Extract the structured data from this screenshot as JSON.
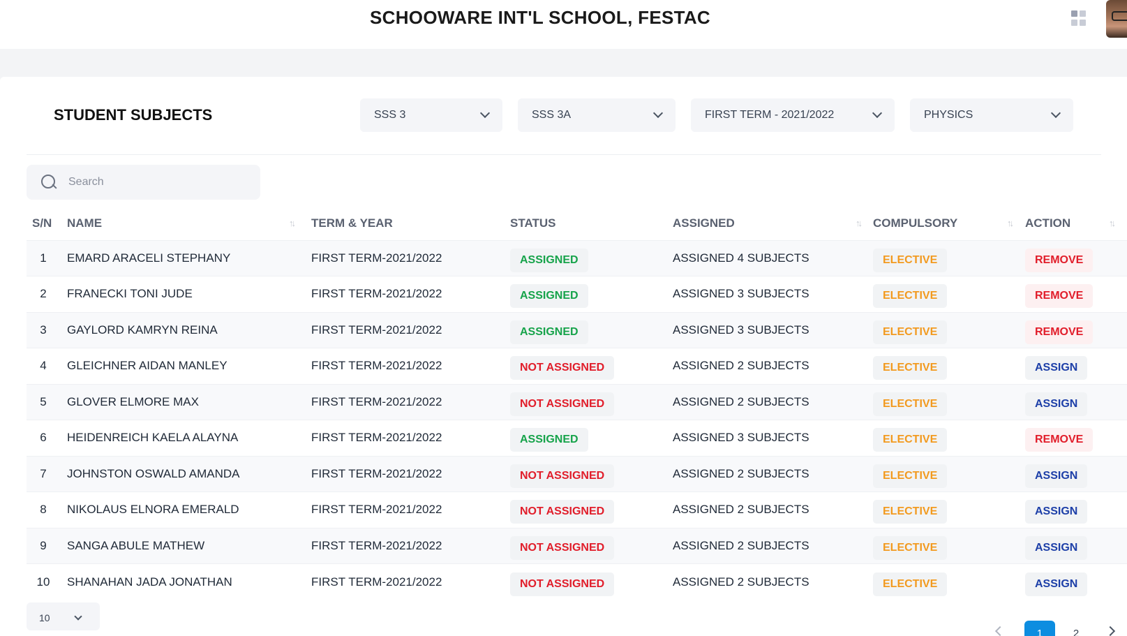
{
  "header": {
    "school_name": "SCHOOWARE INT'L SCHOOL, FESTAC",
    "apps_icon": "grid-apps-icon",
    "avatar_icon": "user-avatar"
  },
  "page": {
    "title": "STUDENT SUBJECTS",
    "filters": {
      "class": "SSS 3",
      "arm": "SSS 3A",
      "term": "FIRST TERM - 2021/2022",
      "subject": "PHYSICS"
    },
    "search": {
      "placeholder": "Search",
      "value": ""
    }
  },
  "table": {
    "columns": {
      "sn": "S/N",
      "name": "NAME",
      "term_year": "TERM & YEAR",
      "status": "STATUS",
      "assigned": "ASSIGNED",
      "compulsory": "COMPULSORY",
      "action": "ACTION"
    },
    "sort_glyph": "↑↓",
    "rows": [
      {
        "sn": "1",
        "name": "EMARD ARACELI STEPHANY",
        "term_year": "FIRST TERM-2021/2022",
        "status": "ASSIGNED",
        "assigned": "ASSIGNED 4 SUBJECTS",
        "compulsory": "ELECTIVE",
        "action": "REMOVE"
      },
      {
        "sn": "2",
        "name": "FRANECKI TONI JUDE",
        "term_year": "FIRST TERM-2021/2022",
        "status": "ASSIGNED",
        "assigned": "ASSIGNED 3 SUBJECTS",
        "compulsory": "ELECTIVE",
        "action": "REMOVE"
      },
      {
        "sn": "3",
        "name": "GAYLORD KAMRYN REINA",
        "term_year": "FIRST TERM-2021/2022",
        "status": "ASSIGNED",
        "assigned": "ASSIGNED 3 SUBJECTS",
        "compulsory": "ELECTIVE",
        "action": "REMOVE"
      },
      {
        "sn": "4",
        "name": "GLEICHNER AIDAN MANLEY",
        "term_year": "FIRST TERM-2021/2022",
        "status": "NOT ASSIGNED",
        "assigned": "ASSIGNED 2 SUBJECTS",
        "compulsory": "ELECTIVE",
        "action": "ASSIGN"
      },
      {
        "sn": "5",
        "name": "GLOVER ELMORE MAX",
        "term_year": "FIRST TERM-2021/2022",
        "status": "NOT ASSIGNED",
        "assigned": "ASSIGNED 2 SUBJECTS",
        "compulsory": "ELECTIVE",
        "action": "ASSIGN"
      },
      {
        "sn": "6",
        "name": "HEIDENREICH KAELA ALAYNA",
        "term_year": "FIRST TERM-2021/2022",
        "status": "ASSIGNED",
        "assigned": "ASSIGNED 3 SUBJECTS",
        "compulsory": "ELECTIVE",
        "action": "REMOVE"
      },
      {
        "sn": "7",
        "name": "JOHNSTON OSWALD AMANDA",
        "term_year": "FIRST TERM-2021/2022",
        "status": "NOT ASSIGNED",
        "assigned": "ASSIGNED 2 SUBJECTS",
        "compulsory": "ELECTIVE",
        "action": "ASSIGN"
      },
      {
        "sn": "8",
        "name": "NIKOLAUS ELNORA EMERALD",
        "term_year": "FIRST TERM-2021/2022",
        "status": "NOT ASSIGNED",
        "assigned": "ASSIGNED 2 SUBJECTS",
        "compulsory": "ELECTIVE",
        "action": "ASSIGN"
      },
      {
        "sn": "9",
        "name": "SANGA ABULE MATHEW",
        "term_year": "FIRST TERM-2021/2022",
        "status": "NOT ASSIGNED",
        "assigned": "ASSIGNED 2 SUBJECTS",
        "compulsory": "ELECTIVE",
        "action": "ASSIGN"
      },
      {
        "sn": "10",
        "name": "SHANAHAN JADA JONATHAN",
        "term_year": "FIRST TERM-2021/2022",
        "status": "NOT ASSIGNED",
        "assigned": "ASSIGNED 2 SUBJECTS",
        "compulsory": "ELECTIVE",
        "action": "ASSIGN"
      }
    ]
  },
  "pagination": {
    "page_size": "10",
    "pages": [
      "1",
      "2"
    ],
    "current_page": "1"
  },
  "colors": {
    "assigned": "#16a34a",
    "not_assigned": "#e11d2a",
    "elective": "#f29a1f",
    "assign_action": "#1d3fa8",
    "active_page": "#0d8de0"
  }
}
